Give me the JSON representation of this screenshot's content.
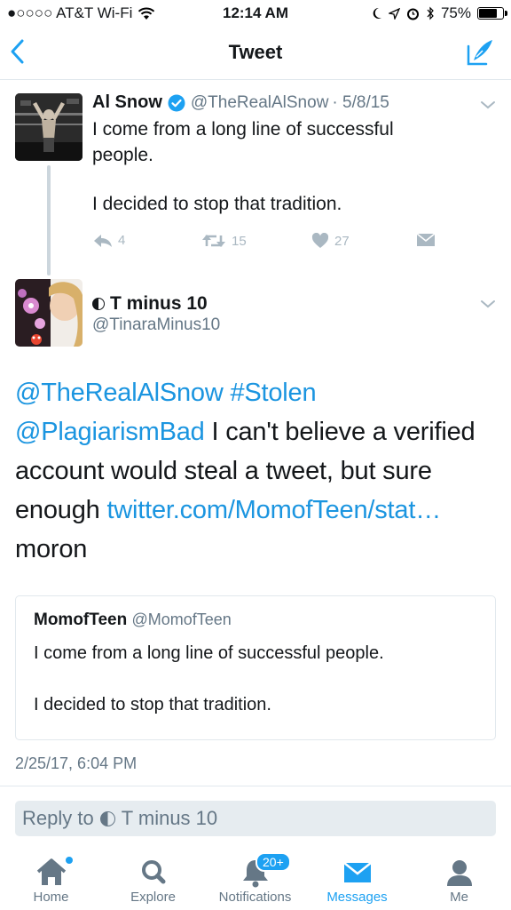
{
  "status_bar": {
    "carrier": "●○○○○ AT&T Wi-Fi",
    "time": "12:14 AM",
    "battery": "75%",
    "battery_level": 0.75
  },
  "nav": {
    "title": "Tweet"
  },
  "parent_tweet": {
    "name": "Al Snow",
    "handle": "@TheRealAlSnow",
    "date": "· 5/8/15",
    "text_line1": "I come from a long line of successful people.",
    "text_line2": "I decided to stop that tradition.",
    "reply_count": "4",
    "retweet_count": "15",
    "like_count": "27"
  },
  "main_tweet": {
    "name": "T minus 10",
    "handle": "@TinaraMinus10",
    "mention1": "@TheRealAlSnow",
    "hashtag": "#Stolen",
    "mention2": "@PlagiarismBad",
    "text_part1": " I can't believe a verified account would steal a tweet, but sure enough ",
    "link": "twitter.com/MomofTeen/stat…",
    "text_part2": " moron",
    "timestamp": "2/25/17, 6:04 PM"
  },
  "quoted_tweet": {
    "name": "MomofTeen",
    "handle": "@MomofTeen",
    "text_line1": "I come from a long line of successful people.",
    "text_line2": "I decided to stop that tradition."
  },
  "reply_box": {
    "prefix": "Reply to",
    "target": "T minus 10"
  },
  "tab_bar": {
    "home": "Home",
    "explore": "Explore",
    "notifications": "Notifications",
    "notifications_badge": "20+",
    "messages": "Messages",
    "me": "Me"
  },
  "colors": {
    "accent": "#1da1f2",
    "link": "#1b95e0",
    "muted": "#657786"
  }
}
